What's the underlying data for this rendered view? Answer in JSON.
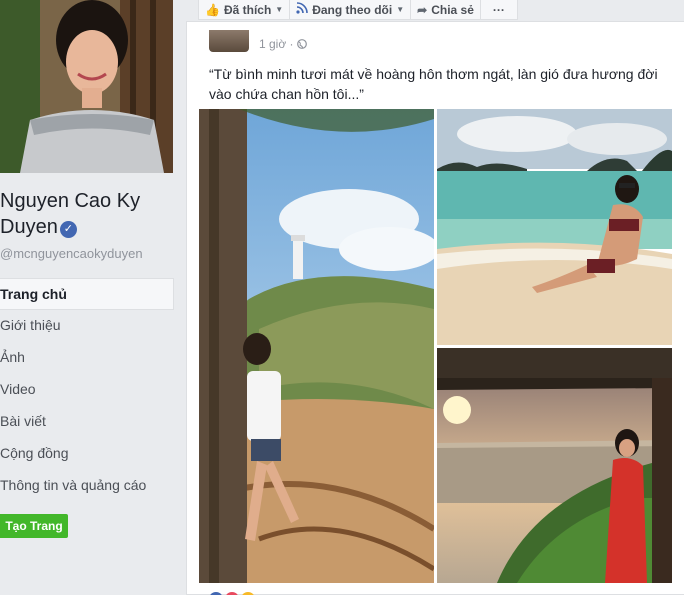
{
  "sidebar": {
    "page_name_line1": "Nguyen Cao Ky",
    "page_name_line2": "Duyen",
    "verified_icon": "check-icon",
    "handle": "@mcnguyencaokyduyen",
    "nav": [
      {
        "label": "Trang chủ",
        "active": true
      },
      {
        "label": "Giới thiệu"
      },
      {
        "label": "Ảnh"
      },
      {
        "label": "Video"
      },
      {
        "label": "Bài viết"
      },
      {
        "label": "Cộng đồng"
      },
      {
        "label": "Thông tin và quảng cáo"
      }
    ],
    "create_page_label": "Tạo Trang"
  },
  "action_bar": {
    "liked_label": "Đã thích",
    "following_label": "Đang theo dõi",
    "share_label": "Chia sẻ",
    "more_label": "···"
  },
  "post": {
    "time": "1 giờ ·",
    "text": "“Từ bình minh tươi mát về hoàng hôn thơm ngát, làn gió đưa hương đời vào chứa chan hồn tôi...”"
  },
  "colors": {
    "brand_blue": "#4267b2",
    "green_button": "#42b72a",
    "background": "#e9ebee"
  }
}
